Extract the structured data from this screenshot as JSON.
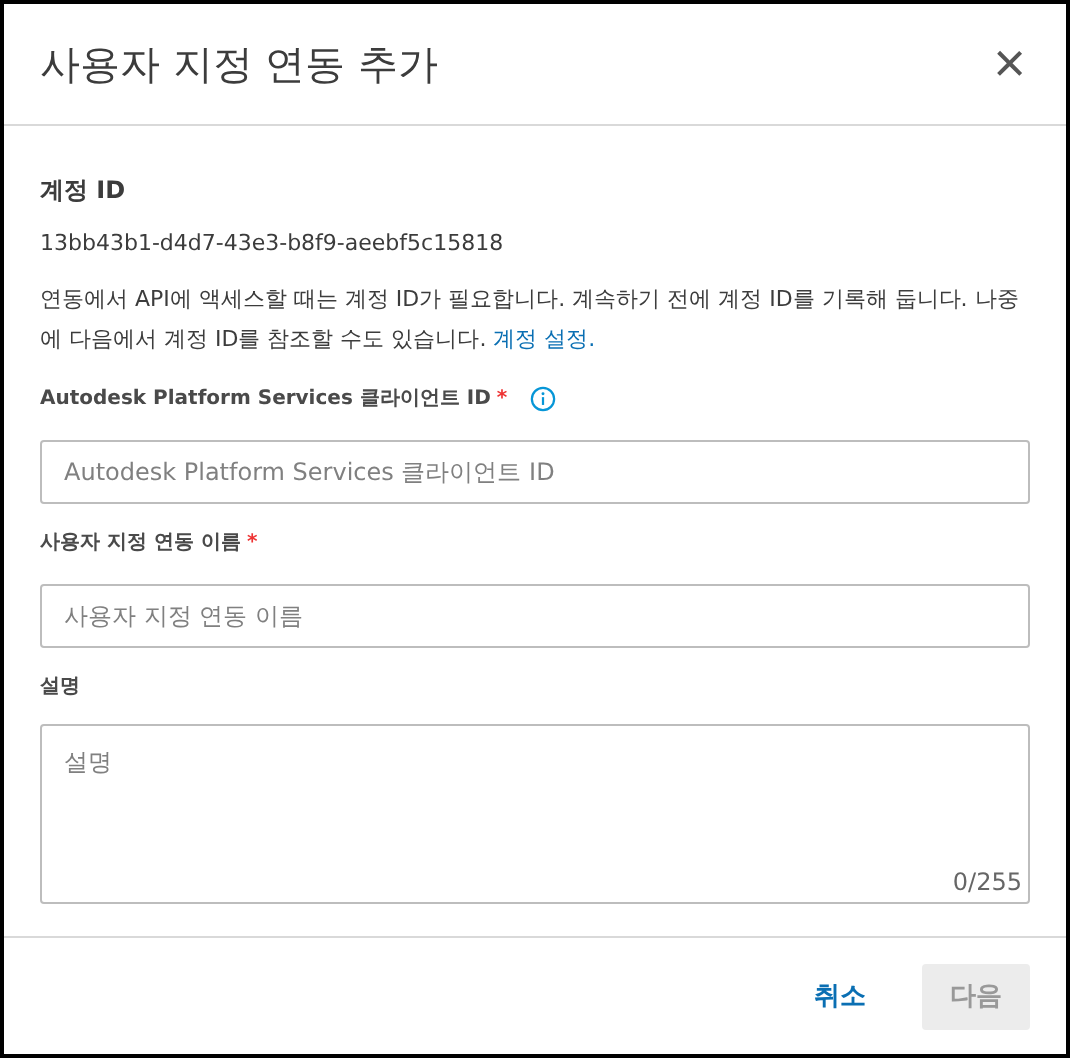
{
  "dialog": {
    "title": "사용자 지정 연동 추가",
    "close": "×"
  },
  "account": {
    "label": "계정 ID",
    "value": "13bb43b1-d4d7-43e3-b8f9-aeebf5c15818",
    "description": "연동에서 API에 액세스할 때는 계정 ID가 필요합니다. 계속하기 전에 계정 ID를 기록해 둡니다. 나중에 다음에서 계정 ID를 참조할 수도 있습니다.",
    "link": "계정 설정."
  },
  "fields": [
    {
      "kind": "input",
      "label": "Autodesk Platform Services 클라이언트 ID",
      "required_mark": "*",
      "info": true,
      "placeholder": "Autodesk Platform Services 클라이언트 ID"
    },
    {
      "kind": "input",
      "label": "사용자 지정 연동 이름",
      "required_mark": "*",
      "info": false,
      "placeholder": "사용자 지정 연동 이름"
    },
    {
      "kind": "textarea",
      "label": "설명",
      "info": false,
      "placeholder": "설명",
      "counter": "0/255"
    }
  ],
  "buttons": [
    {
      "kind": "link",
      "label": "취소",
      "disabled": false
    },
    {
      "kind": "primary",
      "label": "다음",
      "disabled": true
    }
  ]
}
